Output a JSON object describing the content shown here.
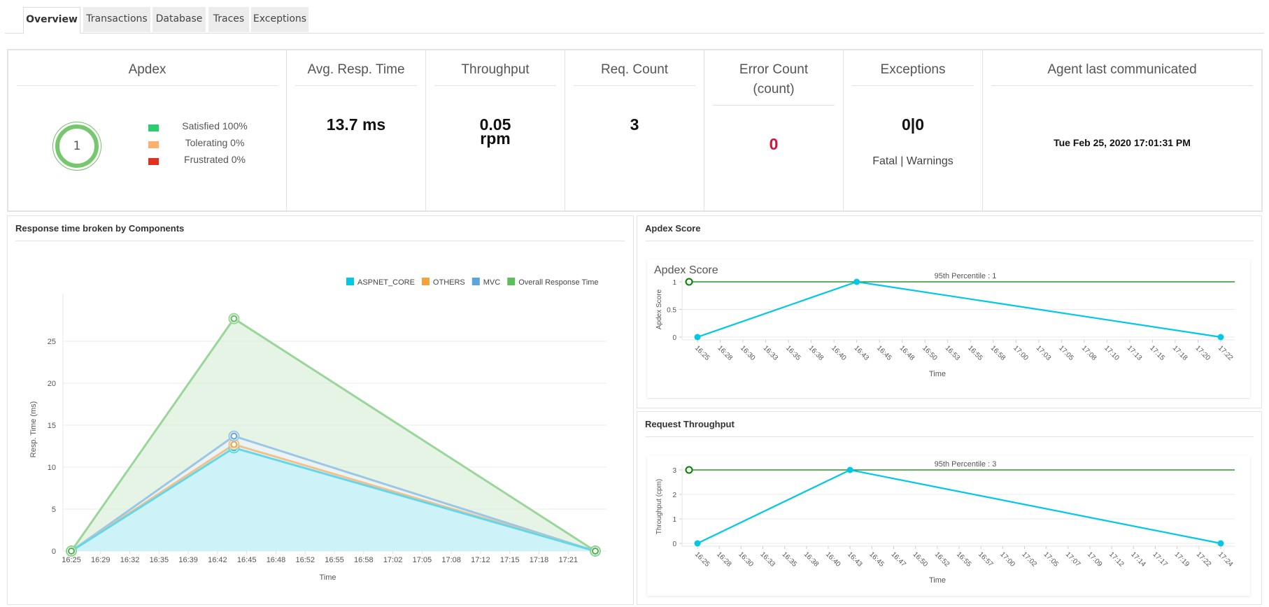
{
  "tabs": [
    {
      "label": "Overview",
      "active": true
    },
    {
      "label": "Transactions",
      "active": false
    },
    {
      "label": "Database",
      "active": false
    },
    {
      "label": "Traces",
      "active": false
    },
    {
      "label": "Exceptions",
      "active": false
    }
  ],
  "cards": {
    "apdex": {
      "title": "Apdex",
      "score": "1",
      "legend": [
        {
          "label": "Satisfied 100%",
          "color": "#2ecc71"
        },
        {
          "label": "Tolerating 0%",
          "color": "#f8b26e"
        },
        {
          "label": "Frustrated 0%",
          "color": "#e03020"
        }
      ]
    },
    "avg_resp": {
      "title": "Avg. Resp. Time",
      "value": "13.7 ms"
    },
    "throughput": {
      "title": "Throughput",
      "value": "0.05",
      "unit": "rpm"
    },
    "req_count": {
      "title": "Req. Count",
      "value": "3"
    },
    "error_count": {
      "title_line1": "Error Count",
      "title_line2": "(count)",
      "value": "0",
      "color": "#d0143c"
    },
    "exceptions": {
      "title": "Exceptions",
      "value": "0|0",
      "sub": "Fatal | Warnings"
    },
    "agent": {
      "title": "Agent last communicated",
      "value": "Tue Feb 25, 2020 17:01:31 PM"
    }
  },
  "panels": {
    "response_time": {
      "title": "Response time broken by Components"
    },
    "apdex_score": {
      "title": "Apdex Score"
    },
    "throughput": {
      "title": "Request Throughput"
    }
  },
  "chart_data": [
    {
      "type": "area",
      "title": "Response time broken by Components",
      "xlabel": "Time",
      "ylabel": "Resp. Time (ms)",
      "ylim": [
        0,
        29
      ],
      "yticks": [
        0,
        5,
        10,
        15,
        20,
        25
      ],
      "grid": true,
      "legend_position": "top-right",
      "x_tick_labels": [
        "16:25",
        "16:29",
        "16:32",
        "16:35",
        "16:39",
        "16:42",
        "16:45",
        "16:48",
        "16:52",
        "16:55",
        "16:58",
        "17:02",
        "17:05",
        "17:08",
        "17:12",
        "17:15",
        "17:18",
        "17:21"
      ],
      "x_points": [
        "16:25",
        "16:43",
        "17:23"
      ],
      "x_range_minutes": [
        0,
        58
      ],
      "x_point_minutes": [
        0,
        18,
        58
      ],
      "series": [
        {
          "name": "ASPNET_CORE",
          "color": "#00c8e6",
          "values": [
            0,
            12.3,
            0
          ]
        },
        {
          "name": "OTHERS",
          "color": "#f5a23c",
          "values": [
            0,
            12.7,
            0
          ]
        },
        {
          "name": "MVC",
          "color": "#5aa5dc",
          "values": [
            0,
            13.7,
            0
          ]
        },
        {
          "name": "Overall Response Time",
          "color": "#5cbf5c",
          "values": [
            0,
            27.7,
            0
          ]
        }
      ]
    },
    {
      "type": "line",
      "title": "Apdex Score",
      "inner_title": "Apdex Score",
      "xlabel": "Time",
      "ylabel": "Apdex Score",
      "ylim": [
        0,
        1
      ],
      "yticks": [
        "0",
        "0.5",
        "1"
      ],
      "ytick_values": [
        0,
        0.5,
        1
      ],
      "grid": true,
      "x_tick_labels": [
        "16:25",
        "16:28",
        "16:30",
        "16:33",
        "16:35",
        "16:38",
        "16:40",
        "16:43",
        "16:45",
        "16:48",
        "16:50",
        "16:53",
        "16:55",
        "16:58",
        "17:00",
        "17:03",
        "17:05",
        "17:08",
        "17:10",
        "17:13",
        "17:15",
        "17:18",
        "17:20",
        "17:22"
      ],
      "series": [
        {
          "name": "Apdex Score",
          "color": "#00c8e6",
          "x_index": [
            0,
            7,
            23
          ],
          "values": [
            0,
            1,
            0
          ]
        }
      ],
      "reference_line": {
        "label": "95th Percentile : 1",
        "value": 1,
        "color": "#008000"
      }
    },
    {
      "type": "line",
      "title": "Request Throughput",
      "xlabel": "Time",
      "ylabel": "Throughput (cpm)",
      "ylim": [
        0,
        3
      ],
      "yticks": [
        "0",
        "1",
        "2",
        "3"
      ],
      "ytick_values": [
        0,
        1,
        2,
        3
      ],
      "grid": true,
      "x_tick_labels": [
        "16:25",
        "16:28",
        "16:30",
        "16:33",
        "16:35",
        "16:38",
        "16:40",
        "16:43",
        "16:45",
        "16:47",
        "16:50",
        "16:52",
        "16:55",
        "16:57",
        "17:00",
        "17:02",
        "17:05",
        "17:07",
        "17:09",
        "17:12",
        "17:14",
        "17:17",
        "17:19",
        "17:22",
        "17:24"
      ],
      "series": [
        {
          "name": "Throughput",
          "color": "#00c8e6",
          "x_index": [
            0,
            7,
            24
          ],
          "values": [
            0,
            3,
            0
          ]
        }
      ],
      "reference_line": {
        "label": "95th Percentile : 3",
        "value": 3,
        "color": "#008000"
      }
    }
  ]
}
